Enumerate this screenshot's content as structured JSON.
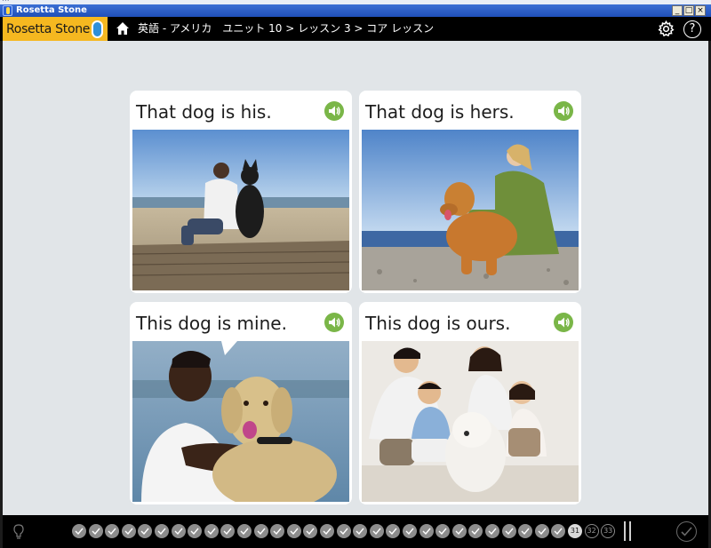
{
  "url_strip": "...",
  "window": {
    "title": "Rosetta Stone",
    "minimize": "_",
    "maximize": "□",
    "close": "×"
  },
  "header": {
    "logo_text": "Rosetta Stone",
    "breadcrumb": "英語 - アメリカ　ユニット 10 > レッスン 3 > コア レッスン",
    "icons": [
      "home-icon",
      "gear-icon",
      "help-icon"
    ],
    "help_label": "?"
  },
  "cards": [
    {
      "caption": "That dog is his."
    },
    {
      "caption": "That dog is hers."
    },
    {
      "caption": "This dog is mine."
    },
    {
      "caption": "This dog is ours."
    }
  ],
  "progress": {
    "completed_count": 30,
    "current_label": "31",
    "upcoming_labels": [
      "32",
      "33"
    ]
  },
  "colors": {
    "accent_green": "#7ab648",
    "logo_yellow": "#f5b820",
    "header_black": "#000000",
    "main_background": "#e1e5e8"
  }
}
